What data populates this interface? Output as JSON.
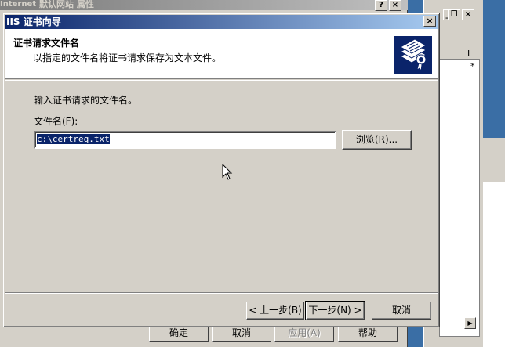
{
  "background": {
    "properties_window_title": "默认网站 属性",
    "mmc_left_title": "Internet I",
    "dialog_buttons": [
      {
        "label": "确定",
        "enabled": true
      },
      {
        "label": "取消",
        "enabled": true
      },
      {
        "label": "应用(A)",
        "enabled": false
      },
      {
        "label": "帮助",
        "enabled": true
      }
    ],
    "list_column_header": "I",
    "list_item_marker": "*"
  },
  "wizard": {
    "title": "IIS 证书向导",
    "heading": "证书请求文件名",
    "subheading": "以指定的文件名将证书请求保存为文本文件。",
    "instruction": "输入证书请求的文件名。",
    "filename_label": "文件名(F):",
    "filename_value": "c:\\certreq.txt",
    "browse_label": "浏览(R)...",
    "back_label": "< 上一步(B)",
    "next_label": "下一步(N) >",
    "cancel_label": "取消"
  },
  "colors": {
    "desktop": "#3a6ea5",
    "title_active": "#0a246a",
    "face": "#d4d0c8"
  }
}
